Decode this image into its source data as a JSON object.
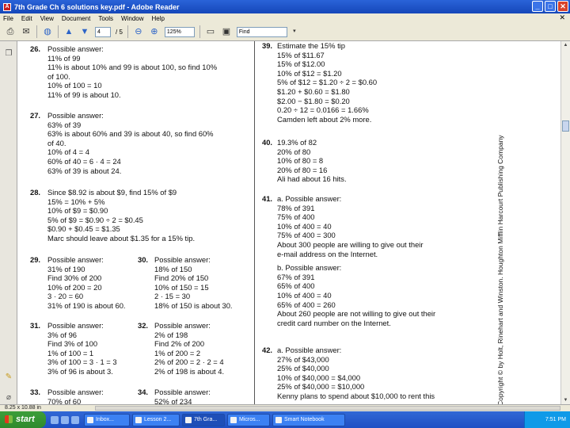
{
  "window": {
    "title": "7th Grade Ch 6 solutions key.pdf - Adobe Reader",
    "controls": [
      "_",
      "□",
      "✕"
    ]
  },
  "menu": [
    "File",
    "Edit",
    "View",
    "Document",
    "Tools",
    "Window",
    "Help"
  ],
  "toolbar": {
    "page_current": "4",
    "page_total": "/ 5",
    "zoom": "125%",
    "find_placeholder": "Find"
  },
  "document": {
    "left_column": [
      {
        "num": "26.",
        "lines": [
          "Possible answer:",
          "11% of 99",
          "11% is about 10% and 99 is about 100, so find 10%",
          "of 100.",
          "10% of 100 = 10",
          "11% of 99 is about 10."
        ]
      },
      {
        "num": "27.",
        "lines": [
          "Possible answer:",
          "63% of 39",
          "63% is about 60% and 39 is about 40, so find 60%",
          "of 40.",
          "10% of 4 = 4",
          "60% of 40 = 6 · 4 = 24",
          "63% of 39 is about 24."
        ]
      },
      {
        "num": "28.",
        "lines": [
          "Since $8.92 is about $9, find 15% of $9",
          "15% = 10% + 5%",
          "10% of $9 = $0.90",
          "5% of $9 = $0.90 ÷ 2 = $0.45",
          "$0.90 + $0.45 = $1.35",
          "Marc should leave about $1.35 for a 15% tip."
        ]
      },
      {
        "num": "29.",
        "lines": [
          "Possible answer:",
          "31% of 190",
          "Find 30% of 200",
          "10% of 200 = 20",
          "3 · 20 = 60",
          "31% of 190 is about 60."
        ]
      },
      {
        "num": "30.",
        "lines": [
          "Possible answer:",
          "18% of 150",
          "Find 20% of 150",
          "10% of 150 = 15",
          "2 · 15 = 30",
          "18% of 150 is about 30."
        ]
      },
      {
        "num": "31.",
        "lines": [
          "Possible answer:",
          "3% of 96",
          "Find 3% of 100",
          "1% of 100 = 1",
          "3% of 100 = 3 · 1 = 3",
          "3% of 96 is about 3."
        ]
      },
      {
        "num": "32.",
        "lines": [
          "Possible answer:",
          "2% of 198",
          "Find 2% of 200",
          "1% of 200 = 2",
          "2% of 200 = 2 · 2 = 4",
          "2% of 198 is about 4."
        ]
      },
      {
        "num": "33.",
        "lines": [
          "Possible answer:",
          "70% of 60"
        ]
      },
      {
        "num": "34.",
        "lines": [
          "Possible answer:",
          "52% of 234"
        ]
      }
    ],
    "right_column": [
      {
        "num": "39.",
        "lines": [
          "Estimate the 15% tip",
          "15% of $11.67",
          "15% of $12.00",
          "10% of $12 = $1.20",
          "5% of $12 = $1.20 ÷ 2 = $0.60",
          "$1.20 + $0.60 = $1.80",
          "$2.00 − $1.80 = $0.20",
          "0.20 ÷ 12 = 0.0166 = 1.66%",
          "Camden left about 2% more."
        ]
      },
      {
        "num": "40.",
        "lines": [
          "19.3% of 82",
          "20% of 80",
          "10% of 80 = 8",
          "20% of 80 = 16",
          "Ali had about 16 hits."
        ]
      },
      {
        "num": "41.",
        "lines": [
          "a. Possible answer:",
          "78% of 391",
          "75% of 400",
          "10% of 400 = 40",
          "75% of 400 = 300",
          "About 300 people are willing to give out their",
          "e-mail address on the Internet.",
          "",
          "b. Possible answer:",
          "67% of 391",
          "65% of 400",
          "10% of 400 = 40",
          "65% of 400 = 260",
          "About 260 people are not willing to give out their",
          "credit card number on the Internet."
        ]
      },
      {
        "num": "42.",
        "lines": [
          "a. Possible answer:",
          "27% of $43,000",
          "25% of $40,000",
          "10% of $40,000 = $4,000",
          "25% of $40,000 = $10,000",
          "Kenny plans to spend about $10,000 to rent this"
        ]
      }
    ],
    "credit": "Copyright © by Holt, Rinehart and Winston. Houghton Mifflin Harcourt Publishing Company"
  },
  "status": {
    "page_size": "8.25 x 10.88 in"
  },
  "taskbar": {
    "start": "start",
    "tasks": [
      "Inbox...",
      "Lesson 2...",
      "7th Gra...",
      "Micros...",
      "Smart Notebook"
    ],
    "clock": "7:51 PM"
  }
}
